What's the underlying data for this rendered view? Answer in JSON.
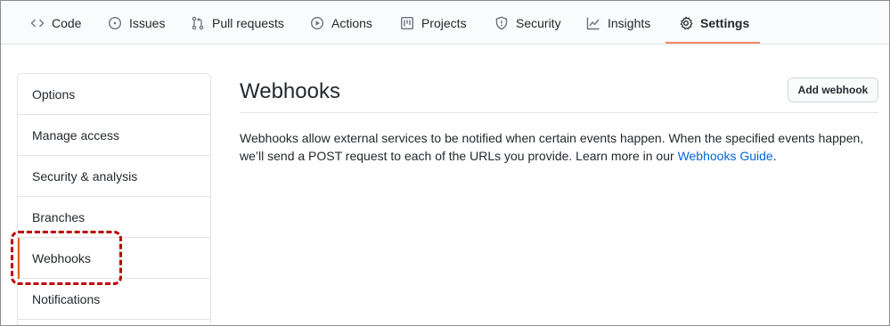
{
  "nav": {
    "tabs": [
      {
        "label": "Code",
        "icon": "code-icon"
      },
      {
        "label": "Issues",
        "icon": "issue-opened-icon"
      },
      {
        "label": "Pull requests",
        "icon": "git-pull-request-icon"
      },
      {
        "label": "Actions",
        "icon": "play-icon"
      },
      {
        "label": "Projects",
        "icon": "project-icon"
      },
      {
        "label": "Security",
        "icon": "shield-icon"
      },
      {
        "label": "Insights",
        "icon": "graph-icon"
      },
      {
        "label": "Settings",
        "icon": "gear-icon",
        "selected": true
      }
    ],
    "accent": "#f9826c"
  },
  "sidebar": {
    "items": [
      {
        "label": "Options"
      },
      {
        "label": "Manage access"
      },
      {
        "label": "Security & analysis"
      },
      {
        "label": "Branches"
      },
      {
        "label": "Webhooks",
        "selected": true
      },
      {
        "label": "Notifications"
      }
    ],
    "selected_accent": "#e36209",
    "highlight_color": "#c00000"
  },
  "main": {
    "title": "Webhooks",
    "add_button_label": "Add webhook",
    "description_text": "Webhooks allow external services to be notified when certain events happen. When the specified events happen, we’ll send a POST request to each of the URLs you provide. Learn more in our ",
    "guide_link": "Webhooks Guide",
    "description_end": ".",
    "link_color": "#0366d6"
  }
}
